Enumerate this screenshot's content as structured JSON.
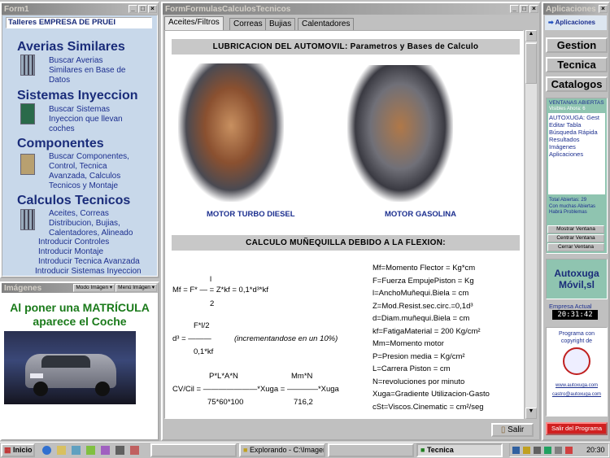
{
  "form1": {
    "title": "Form1",
    "header": "Talleres EMPRESA DE PRUEI",
    "sections": [
      {
        "title": "Averias Similares",
        "text": "Buscar Averias Similares en Base de Datos"
      },
      {
        "title": "Sistemas Inyeccion",
        "text": "Buscar Sistemas Inyeccion que llevan coches"
      },
      {
        "title": "Componentes",
        "text": "Buscar Componentes, Control, Tecnica Avanzada, Calculos Tecnicos y Montaje"
      },
      {
        "title": "Calculos Tecnicos",
        "text": "Aceites, Correas Distribucion, Bujias, Calentadores, Alineado"
      }
    ],
    "links": [
      "Introducir Controles",
      "Introducir Montaje",
      "Introducir Tecnica Avanzada",
      "Introducir Sistemas Inyeccion"
    ]
  },
  "imagenes": {
    "title": "Imágenes",
    "mode_label": "Modo Imágen",
    "menu_label": "Menú Imágen",
    "headline": "Al poner una MATRÍCULA aparece el Coche"
  },
  "formulas": {
    "title": "FormFormulasCalculosTecnicos",
    "tabs": [
      "Aceites/Filtros",
      "Correas",
      "Bujias",
      "Calentadores"
    ],
    "banner1": "LUBRICACION DEL AUTOMOVIL: Parametros y Bases de Calculo",
    "engine1": "MOTOR TURBO DIESEL",
    "engine2": "MOTOR GASOLINA",
    "banner2": "CALCULO MUÑEQUILLA DEBIDO A LA FLEXION:",
    "f1_top": "l",
    "f1": "Mf = F* — = Z*kf = 0,1*d³*kf",
    "f1_bot": "2",
    "f2_top": "F*l/2",
    "f2": "d³ = ———",
    "f2_note": "(incrementandose en un 10%)",
    "f2_bot": "0,1*kf",
    "f3_top1": "P*L*A*N",
    "f3_top2": "Mm*N",
    "f3": "CV/Cil = ———————*Xuga = ————*Xuga",
    "f3_bot1": "75*60*100",
    "f3_bot2": "716,2",
    "legend": [
      "Mf=Momento Flector = Kg*cm",
      "F=Fuerza EmpujePiston = Kg",
      "l=AnchoMuñequi.Biela = cm",
      "Z=Mod.Resist.sec.circ.=0,1d³",
      "d=Diam.muñequi.Biela = cm",
      "kf=FatigaMaterial = 200 Kg/cm²",
      "Mm=Momento motor",
      "P=Presion media = Kg/cm²",
      "L=Carrera Piston = cm",
      "N=revoluciones por minuto",
      "Xuga=Gradiente Utilizacion-Gasto",
      "cSt=Viscos.Cinematic = cm²/seg"
    ],
    "salir": "Salir"
  },
  "aplicaciones": {
    "title": "Aplicaciones",
    "header": "Aplicaciones",
    "menu": [
      "Gestion",
      "Tecnica",
      "Catalogos"
    ],
    "ventanas_label": "VENTANAS ABIERTAS",
    "visibles": "Visibles Ahora: 6",
    "list": [
      "AUTOXUGA: Gest",
      "Editar Tabla",
      "Búsqueda Rápida",
      "Resultados",
      "Imágenes",
      "Aplicaciones"
    ],
    "total": "Total Abiertas: 29",
    "warning": "Con muchas Abiertas Habrá Problemas",
    "buttons": [
      "Mostrar Ventana",
      "Centrar Ventana",
      "Cerrar Ventana"
    ],
    "logo1": "Autoxuga",
    "logo2": "Móvil,sl",
    "empresa": "Empresa Actual",
    "clock": "20:31:42",
    "copyright": "Programa con copyright de",
    "url": "www.autoxuga.com",
    "email": "castro@autoxuga.com",
    "exit": "Salir del Programa"
  },
  "taskbar": {
    "start": "Inicio",
    "items": [
      "Explorando - C:\\Imagen...",
      "Tecnica"
    ],
    "time": "20:30"
  },
  "colors": {
    "title_active": "#0a246a",
    "link_blue": "#1c2f8f",
    "panel_green": "#8fc4b0",
    "exit_red": "#d02020"
  }
}
